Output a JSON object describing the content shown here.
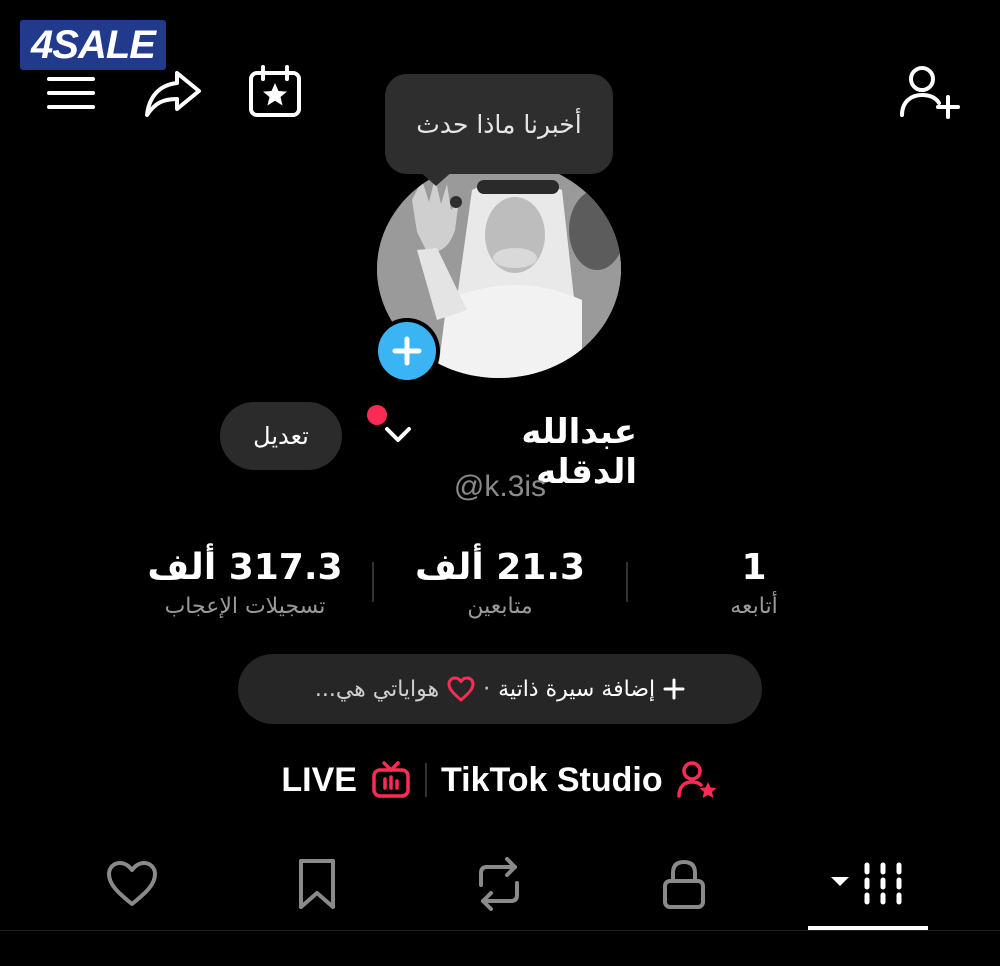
{
  "watermark": {
    "text": "4SALE"
  },
  "header": {
    "menu_icon": "menu-icon",
    "share_icon": "share-icon",
    "calendar_icon": "calendar-star-icon",
    "add_friend_icon": "add-user-icon"
  },
  "tooltip": {
    "text": "أخبرنا ماذا حدث"
  },
  "profile": {
    "name": "عبدالله الدقله",
    "handle": "@k.3is",
    "edit_label": "تعديل",
    "avatar_add_icon": "plus-icon"
  },
  "stats": [
    {
      "value": "1",
      "label": "أتابعه"
    },
    {
      "value": "21.3 ألف",
      "label": "متابعين"
    },
    {
      "value": "317.3 ألف",
      "label": "تسجيلات الإعجاب"
    }
  ],
  "bio": {
    "add_label": "إضافة سيرة ذاتية",
    "dot": "·",
    "hobbies": "هواياتي هي..."
  },
  "links": {
    "studio": "TikTok Studio",
    "live": "LIVE"
  },
  "colors": {
    "accent": "#fe2c55",
    "avatar_add": "#3ab4f2",
    "pill_bg": "#262626"
  },
  "tabs": [
    "grid-icon",
    "lock-icon",
    "repost-icon",
    "bookmark-icon",
    "heart-icon"
  ]
}
